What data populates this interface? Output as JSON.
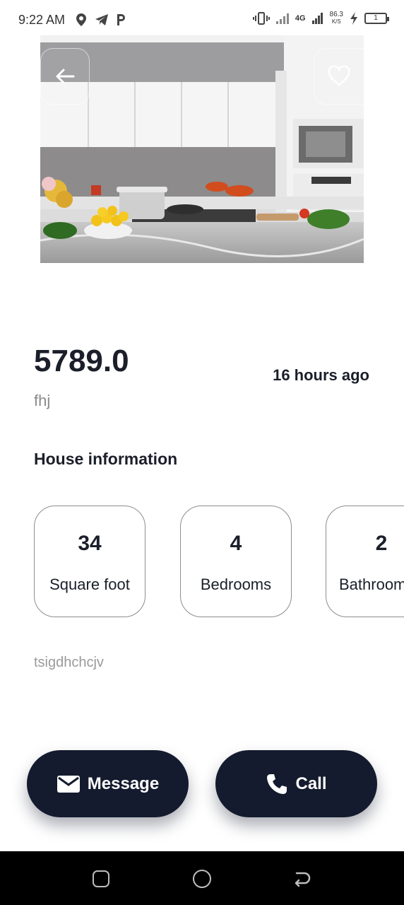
{
  "status_bar": {
    "time": "9:22 AM",
    "network": "4G",
    "speed_value": "86.3",
    "speed_unit": "K/S",
    "battery": "1",
    "left_icons": [
      "location-icon",
      "telegram-icon",
      "parking-icon"
    ],
    "right_icons": [
      "vibrate-icon",
      "signal-icon",
      "signal-4g-icon",
      "charging-icon",
      "battery-icon"
    ]
  },
  "hero": {
    "image": "kitchen-photo",
    "back_icon": "arrow-left-icon",
    "favorite_icon": "heart-outline-icon"
  },
  "listing": {
    "price": "5789.0",
    "posted": "16 hours ago",
    "title": "fhj",
    "section_title": "House information",
    "info": [
      {
        "value": "34",
        "label": "Square foot"
      },
      {
        "value": "4",
        "label": "Bedrooms"
      },
      {
        "value": "2",
        "label": "Bathrooms"
      }
    ],
    "description": "tsigdhchcjv"
  },
  "actions": {
    "message_label": "Message",
    "message_icon": "mail-icon",
    "call_label": "Call",
    "call_icon": "phone-icon"
  },
  "nav": {
    "items": [
      "recents-icon",
      "home-icon",
      "back-icon"
    ]
  },
  "colors": {
    "primary": "#141b2e",
    "muted_text": "#8a8a8a",
    "card_border": "#8d8d8d",
    "nav_bar": "#000000"
  }
}
